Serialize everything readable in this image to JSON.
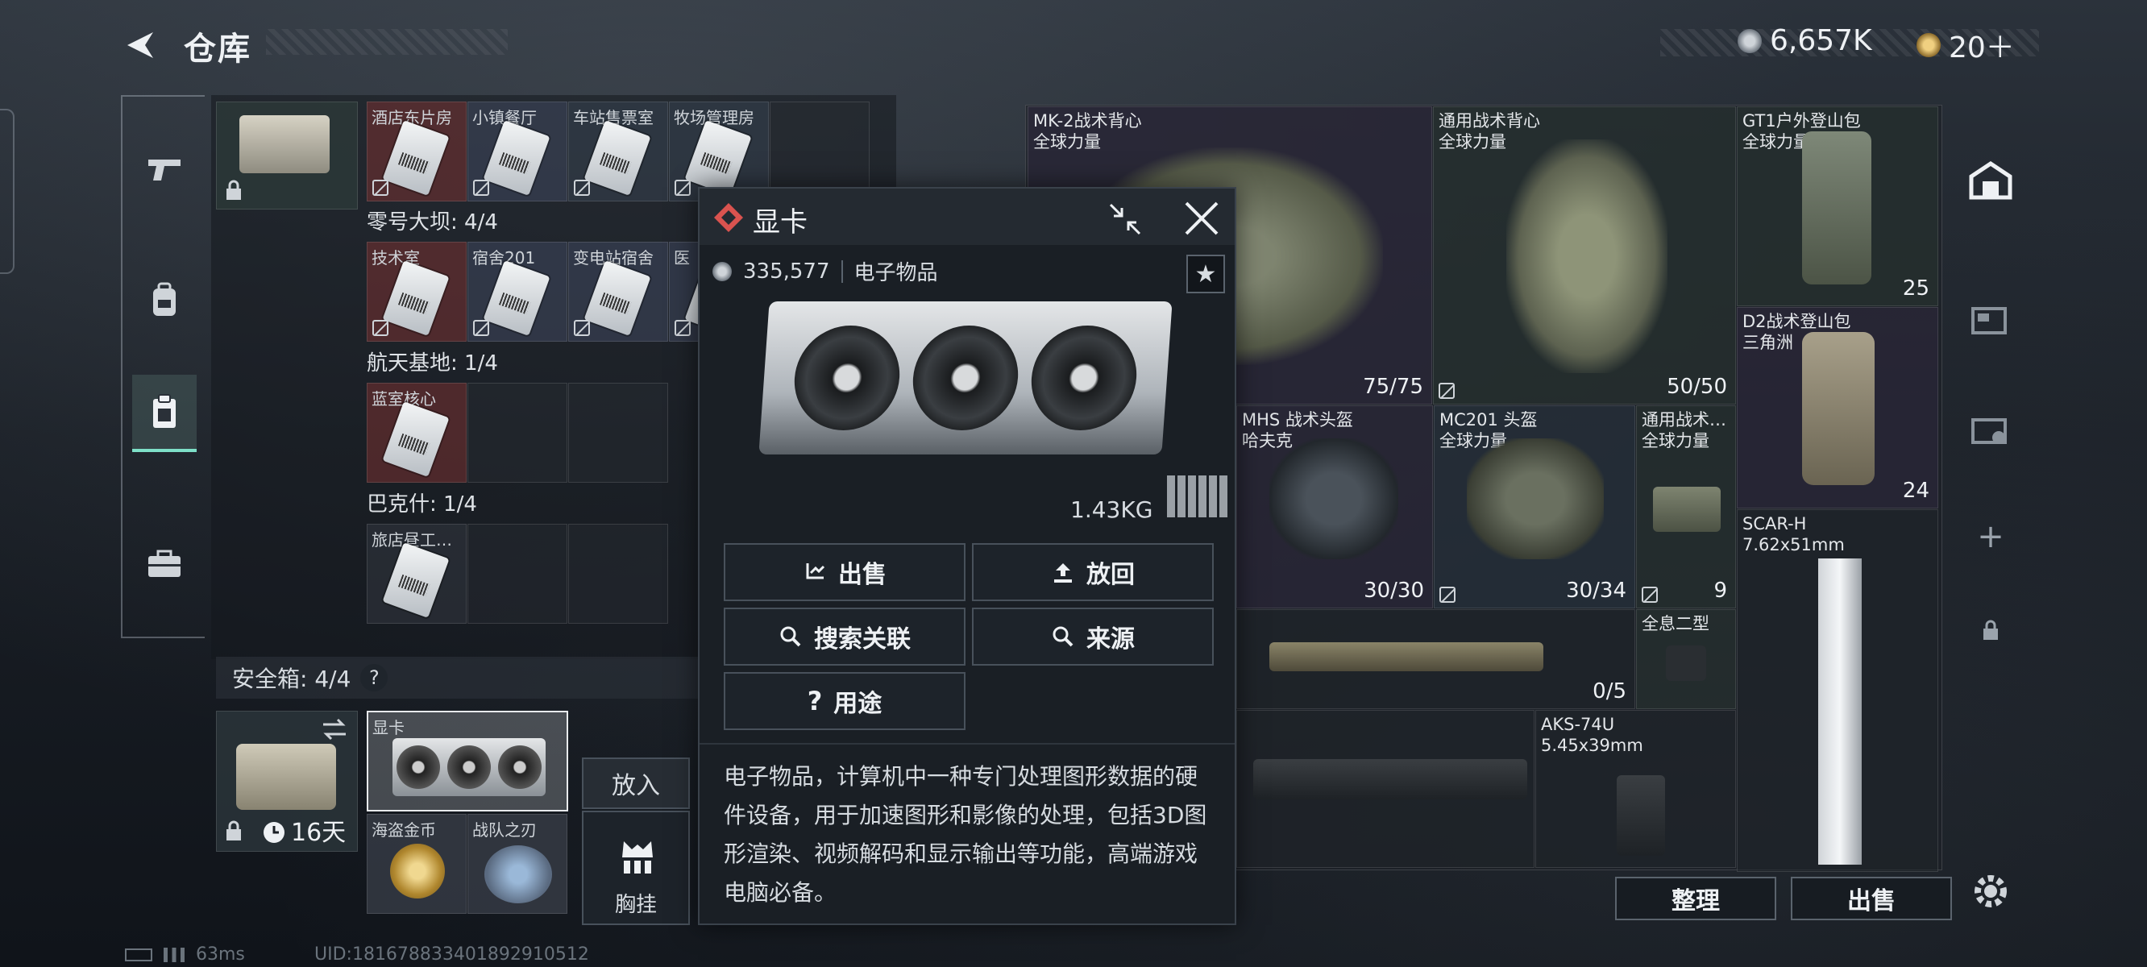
{
  "header": {
    "title": "仓库",
    "currency_1": "6,657K",
    "currency_2": "20＋"
  },
  "stash": {
    "row0": [
      "酒店东片房",
      "小镇餐厅",
      "车站售票室",
      "牧场管理房"
    ],
    "group1": {
      "title": "零号大坝: 4/4",
      "cells": [
        "技术室",
        "宿舍201",
        "变电站宿舍",
        "医"
      ]
    },
    "group2": {
      "title": "航天基地: 1/4",
      "cells": [
        "蓝室核心"
      ]
    },
    "group3": {
      "title": "巴克什: 1/4",
      "cells": [
        "旅店昼工…"
      ]
    }
  },
  "safebox": {
    "title": "安全箱: 4/4",
    "help": "?",
    "days": "16天",
    "slot1": "显卡",
    "slot2": "海盗金币",
    "slot3": "战队之刃",
    "put_in": "放入",
    "vest": "胸挂"
  },
  "popup": {
    "title": "显卡",
    "price": "335,577",
    "category": "电子物品",
    "weight": "1.43KG",
    "buttons": {
      "sell": "出售",
      "return": "放回",
      "search": "搜索关联",
      "source": "来源",
      "usage": "用途"
    },
    "description": "电子物品，计算机中一种专门处理图形数据的硬件设备，用于加速图形和影像的处理，包括3D图形渲染、视频解码和显示输出等功能，高端游戏电脑必备。"
  },
  "items": [
    {
      "name": "MK-2战术背心",
      "sub": "全球力量",
      "dur": "75/75"
    },
    {
      "name": "通用战术背心",
      "sub": "全球力量",
      "dur": "50/50"
    },
    {
      "name": "GT1户外登山包",
      "sub": "全球力量",
      "dur": "25"
    },
    {
      "name": "D2战术登山包",
      "sub": "三角洲",
      "dur": "24"
    },
    {
      "name": "MHS 战术头盔",
      "sub": "哈夫克",
      "dur": "30/30"
    },
    {
      "name": "MC201 头盔",
      "sub": "全球力量",
      "dur": "30/34"
    },
    {
      "name": "通用战术…",
      "sub": "全球力量",
      "dur": "9"
    },
    {
      "name": "SCAR-H",
      "sub": "7.62x51mm",
      "dur": ""
    },
    {
      "name": "",
      "sub": "",
      "dur": "0/5"
    },
    {
      "name": "全息二型",
      "sub": "",
      "dur": ""
    },
    {
      "name": "AKS-74U",
      "sub": "5.45x39mm",
      "dur": ""
    }
  ],
  "footer": {
    "organize": "整理",
    "sell": "出售",
    "ping": "63ms",
    "uid": "UID:1816788334018929105​12"
  },
  "colors": {
    "accent": "#7ee0c8",
    "popup_icon": "#d9534f"
  }
}
